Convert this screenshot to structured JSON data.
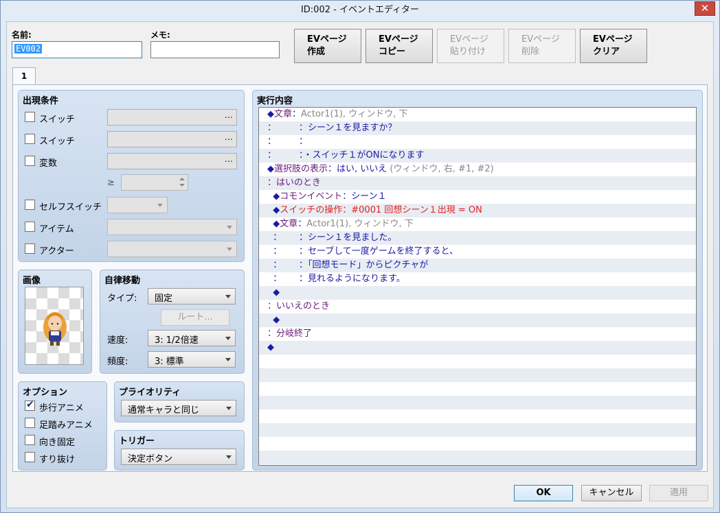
{
  "window": {
    "title": "ID:002 - イベントエディター",
    "close_glyph": "✕"
  },
  "top": {
    "name_label": "名前:",
    "name_value": "EV002",
    "memo_label": "メモ:",
    "memo_value": ""
  },
  "page_buttons": [
    {
      "l1": "EVページ",
      "l2": "作成",
      "enabled": true
    },
    {
      "l1": "EVページ",
      "l2": "コピー",
      "enabled": true
    },
    {
      "l1": "EVページ",
      "l2": "貼り付け",
      "enabled": false
    },
    {
      "l1": "EVページ",
      "l2": "削除",
      "enabled": false
    },
    {
      "l1": "EVページ",
      "l2": "クリア",
      "enabled": true
    }
  ],
  "tab": "1",
  "conditions": {
    "title": "出現条件",
    "switch1": "スイッチ",
    "switch2": "スイッチ",
    "variable": "変数",
    "ge": "≥",
    "self_switch": "セルフスイッチ",
    "item": "アイテム",
    "actor": "アクター",
    "dots": "..."
  },
  "image": {
    "title": "画像"
  },
  "autonomous": {
    "title": "自律移動",
    "type_label": "タイプ:",
    "type_value": "固定",
    "route_label": "ルート...",
    "speed_label": "速度:",
    "speed_value": "3: 1/2倍速",
    "freq_label": "頻度:",
    "freq_value": "3: 標準"
  },
  "options": {
    "title": "オプション",
    "walk": "歩行アニメ",
    "walk_checked": true,
    "step": "足踏みアニメ",
    "dir_fix": "向き固定",
    "through": "すり抜け"
  },
  "priority": {
    "title": "プライオリティ",
    "value": "通常キャラと同じ"
  },
  "trigger": {
    "title": "トリガー",
    "value": "決定ボタン"
  },
  "contents": {
    "title": "実行内容",
    "rows": [
      {
        "parts": [
          [
            "c-txt",
            "◆"
          ],
          [
            "c-cmd",
            "文章"
          ],
          [
            "c-txt",
            "："
          ],
          [
            "c-grey",
            "Actor1(1), ウィンドウ, 下"
          ]
        ]
      },
      {
        "parts": [
          [
            "c-txt",
            "：        ：シーン１を見ますか？"
          ]
        ]
      },
      {
        "parts": [
          [
            "c-txt",
            "：        ："
          ]
        ]
      },
      {
        "parts": [
          [
            "c-txt",
            "：        ：・スイッチ１がONになります"
          ]
        ]
      },
      {
        "parts": [
          [
            "c-txt",
            "◆"
          ],
          [
            "c-cmd",
            "選択肢の表示"
          ],
          [
            "c-txt",
            "：はい, いいえ "
          ],
          [
            "c-grey",
            "(ウィンドウ, 右, #1, #2)"
          ]
        ]
      },
      {
        "parts": [
          [
            "c-cmd",
            "：はいのとき"
          ]
        ]
      },
      {
        "parts": [
          [
            "c-txt",
            "  ◆"
          ],
          [
            "c-cmd",
            "コモンイベント"
          ],
          [
            "c-txt",
            "：シーン１"
          ]
        ]
      },
      {
        "parts": [
          [
            "c-txt",
            "  ◆"
          ],
          [
            "c-red",
            "スイッチの操作：#0001 回想シーン１出現 = ON"
          ]
        ]
      },
      {
        "parts": [
          [
            "c-txt",
            "  ◆"
          ],
          [
            "c-cmd",
            "文章"
          ],
          [
            "c-txt",
            "："
          ],
          [
            "c-grey",
            "Actor1(1), ウィンドウ, 下"
          ]
        ]
      },
      {
        "parts": [
          [
            "c-txt",
            "  ：      ：シーン１を見ました。"
          ]
        ]
      },
      {
        "parts": [
          [
            "c-txt",
            "  ：      ：セーブして一度ゲームを終了すると、"
          ]
        ]
      },
      {
        "parts": [
          [
            "c-txt",
            "  ：      ：「回想モード」からピクチャが"
          ]
        ]
      },
      {
        "parts": [
          [
            "c-txt",
            "  ：      ：見れるようになります。"
          ]
        ]
      },
      {
        "parts": [
          [
            "c-txt",
            "  ◆"
          ]
        ]
      },
      {
        "parts": [
          [
            "c-cmd",
            "：いいえのとき"
          ]
        ]
      },
      {
        "parts": [
          [
            "c-txt",
            "  ◆"
          ]
        ]
      },
      {
        "parts": [
          [
            "c-cmd",
            "：分岐終了"
          ]
        ]
      },
      {
        "parts": [
          [
            "c-txt",
            "◆"
          ]
        ]
      },
      {
        "parts": []
      },
      {
        "parts": []
      },
      {
        "parts": []
      },
      {
        "parts": []
      },
      {
        "parts": []
      },
      {
        "parts": []
      },
      {
        "parts": []
      },
      {
        "parts": []
      }
    ]
  },
  "footer": {
    "ok": "OK",
    "cancel": "キャンセル",
    "apply": "適用"
  }
}
